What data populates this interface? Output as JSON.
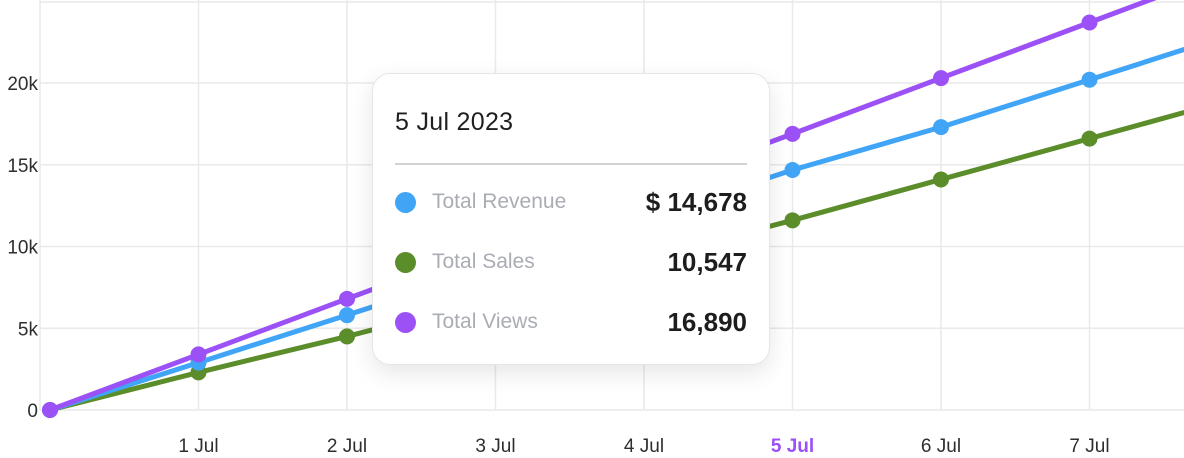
{
  "chart_data": {
    "type": "line",
    "x": [
      "",
      "1 Jul",
      "2 Jul",
      "3 Jul",
      "4 Jul",
      "5 Jul",
      "6 Jul",
      "7 Jul"
    ],
    "active_x": "5 Jul",
    "ylim": [
      0,
      25000
    ],
    "yticks": [
      0,
      5000,
      10000,
      15000,
      20000
    ],
    "ytick_labels": [
      "0",
      "5k",
      "10k",
      "15k",
      "20k"
    ],
    "grid": true,
    "series": [
      {
        "name": "Total Views",
        "color": "#9b51f5",
        "values": [
          0,
          3400,
          6800,
          null,
          null,
          16890,
          20300,
          23700
        ]
      },
      {
        "name": "Total Revenue",
        "color": "#40a4f7",
        "values": [
          0,
          2900,
          5800,
          null,
          null,
          14678,
          17300,
          20200
        ]
      },
      {
        "name": "Total Sales",
        "color": "#5b8d2b",
        "values": [
          0,
          2300,
          4500,
          null,
          null,
          11600,
          14100,
          16600
        ]
      }
    ]
  },
  "tooltip": {
    "date": "5 Jul 2023",
    "rows": [
      {
        "label": "Total Revenue",
        "value": "$ 14,678",
        "color": "#40a4f7"
      },
      {
        "label": "Total Sales",
        "value": "10,547",
        "color": "#5b8d2b"
      },
      {
        "label": "Total Views",
        "value": "16,890",
        "color": "#9b51f5"
      }
    ]
  }
}
